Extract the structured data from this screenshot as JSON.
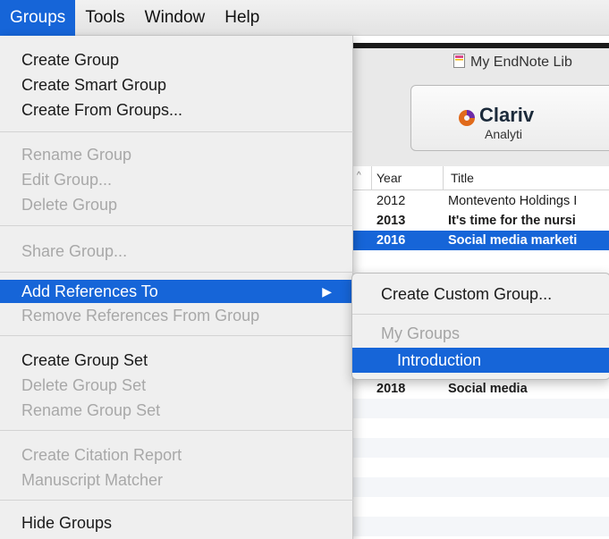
{
  "menubar": {
    "items": [
      {
        "label": "Groups",
        "active": true
      },
      {
        "label": "Tools",
        "active": false
      },
      {
        "label": "Window",
        "active": false
      },
      {
        "label": "Help",
        "active": false
      }
    ]
  },
  "window": {
    "library_title": "My EndNote Lib",
    "brand_name": "Clariv",
    "brand_sub": "Analyti",
    "columns": {
      "year": "Year",
      "title": "Title"
    },
    "rows": [
      {
        "year": "2012",
        "title": "Montevento Holdings I",
        "style": "normal"
      },
      {
        "year": "2013",
        "title": "It's time for the nursi",
        "style": "bold"
      },
      {
        "year": "2016",
        "title": "Social media marketi",
        "style": "selected"
      },
      {
        "year": "2018",
        "title": "Social media",
        "style": "bold"
      }
    ]
  },
  "groups_menu": {
    "sections": [
      [
        {
          "label": "Create Group",
          "enabled": true
        },
        {
          "label": "Create Smart Group",
          "enabled": true
        },
        {
          "label": "Create From Groups...",
          "enabled": true
        }
      ],
      [
        {
          "label": "Rename Group",
          "enabled": false
        },
        {
          "label": "Edit Group...",
          "enabled": false
        },
        {
          "label": "Delete Group",
          "enabled": false
        }
      ],
      [
        {
          "label": "Share Group...",
          "enabled": false
        }
      ],
      [
        {
          "label": "Add References To",
          "enabled": true,
          "highlighted": true,
          "submenu": true
        },
        {
          "label": "Remove References From Group",
          "enabled": false
        }
      ],
      [
        {
          "label": "Create Group Set",
          "enabled": true
        },
        {
          "label": "Delete Group Set",
          "enabled": false
        },
        {
          "label": "Rename Group Set",
          "enabled": false
        }
      ],
      [
        {
          "label": "Create Citation Report",
          "enabled": false
        },
        {
          "label": "Manuscript Matcher",
          "enabled": false
        }
      ],
      [
        {
          "label": "Hide Groups",
          "enabled": true
        }
      ]
    ]
  },
  "submenu": {
    "create_custom": "Create Custom Group...",
    "header": "My Groups",
    "groups": [
      "Introduction"
    ]
  },
  "colors": {
    "accent": "#1665d8",
    "disabled_text": "#a8a8a8",
    "menu_bg": "#efefef"
  },
  "icons": [
    "document-icon",
    "clarivate-logo-icon",
    "sort-ascending-icon",
    "submenu-arrow-icon"
  ]
}
